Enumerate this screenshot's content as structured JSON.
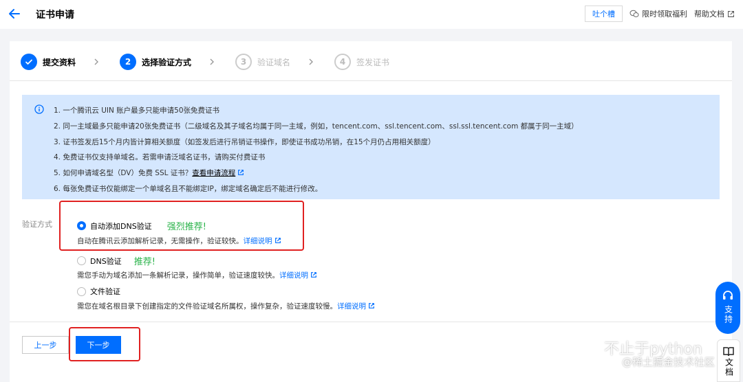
{
  "header": {
    "title": "证书申请",
    "feedback_label": "吐个槽",
    "benefit_label": "限时领取福利",
    "help_label": "帮助文档"
  },
  "steps": [
    {
      "number": "",
      "label": "提交资料",
      "state": "done"
    },
    {
      "number": "2",
      "label": "选择验证方式",
      "state": "active"
    },
    {
      "number": "3",
      "label": "验证域名",
      "state": "pending"
    },
    {
      "number": "4",
      "label": "签发证书",
      "state": "pending"
    }
  ],
  "notice": {
    "line1": "1. 一个腾讯云 UIN 账户最多只能申请50张免费证书",
    "line2": "2. 同一主域最多只能申请20张免费证书（二级域名及其子域名均属于同一主域，例如，tencent.com、ssl.tencent.com、ssl.ssl.tencent.com 都属于同一主域）",
    "line3": "3. 证书签发后15个月内皆计算相关额度（如签发后进行吊销证书操作，即使证书成功吊销，在15个月仍占用相关额度）",
    "line4": "4. 免费证书仅支持单域名。若需申请泛域名证书，请购买付费证书",
    "line5_prefix": "5. 如何申请域名型（DV）免费 SSL 证书？",
    "line5_link": "查看申请流程",
    "line6": "6. 每张免费证书仅能绑定一个单域名且不能绑定IP，绑定域名确定后不能进行修改。"
  },
  "method": {
    "label": "验证方式",
    "options": [
      {
        "label": "自动添加DNS验证",
        "recommend": "强烈推荐!",
        "desc": "自动在腾讯云添加解析记录，无需操作，验证较快。",
        "link": "详细说明",
        "checked": true
      },
      {
        "label": "DNS验证",
        "recommend": "推荐!",
        "desc": "需您手动为域名添加一条解析记录，操作简单，验证速度较快。",
        "link": "详细说明",
        "checked": false
      },
      {
        "label": "文件验证",
        "recommend": "",
        "desc": "需您在域名根目录下创建指定的文件验证域名所属权，操作复杂，验证速度较慢。",
        "link": "详细说明",
        "checked": false
      }
    ]
  },
  "buttons": {
    "prev": "上一步",
    "next": "下一步"
  },
  "float": {
    "support": "支持",
    "docs": "文档"
  },
  "watermark": {
    "line1": "不止于python",
    "line2": "@稀土掘金技术社区"
  },
  "colors": {
    "primary": "#006eff",
    "notice_bg": "#d5e7fe",
    "recommend": "#2ab34a",
    "highlight": "#e02020"
  }
}
